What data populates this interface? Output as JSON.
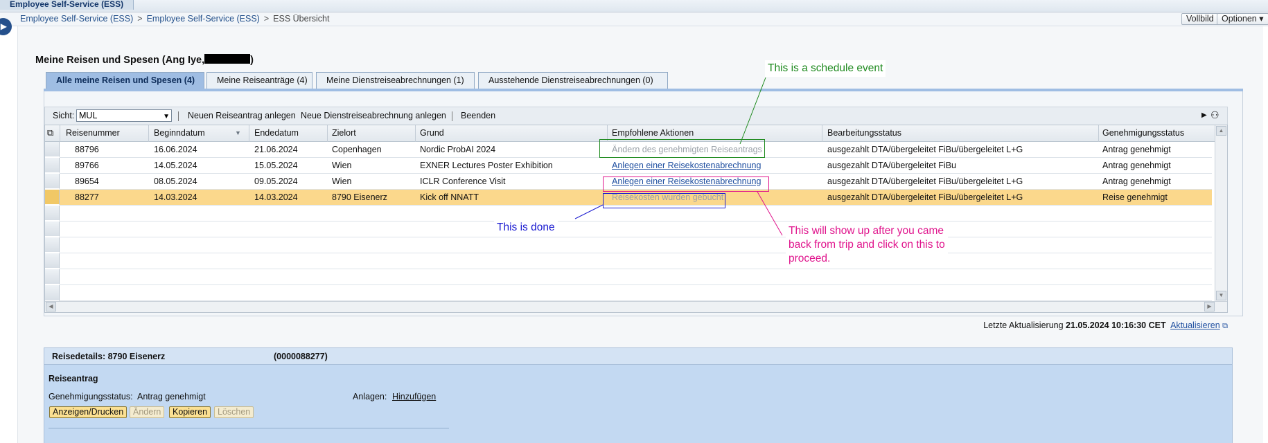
{
  "app": {
    "title": "Employee Self-Service (ESS)"
  },
  "breadcrumb": [
    "Employee Self-Service (ESS)",
    "Employee Self-Service (ESS)",
    "ESS Übersicht"
  ],
  "breadcrumb_separator": ">",
  "header_buttons": {
    "fullscreen": "Vollbild",
    "options": "Optionen"
  },
  "page": {
    "title_prefix": "Meine Reisen und Spesen (Ang Iye,",
    "title_suffix": ")"
  },
  "tabs": [
    {
      "label": "Alle meine Reisen und Spesen (4)",
      "active": true
    },
    {
      "label": "Meine Reiseanträge (4)",
      "active": false
    },
    {
      "label": "Meine Dienstreiseabrechnungen (1)",
      "active": false
    },
    {
      "label": "Ausstehende Dienstreiseabrechnungen (0)",
      "active": false
    }
  ],
  "toolbar": {
    "view_label": "Sicht:",
    "view_value": "MUL",
    "new_request": "Neuen Reiseantrag anlegen",
    "new_expense": "Neue Dienstreiseabrechnung anlegen",
    "finish": "Beenden"
  },
  "table": {
    "columns": [
      "Reisenummer",
      "Beginndatum",
      "Endedatum",
      "Zielort",
      "Grund",
      "Empfohlene Aktionen",
      "Bearbeitungsstatus",
      "Genehmigungsstatus"
    ],
    "rows": [
      {
        "number": "88796",
        "begin": "16.06.2024",
        "end": "21.06.2024",
        "destination": "Copenhagen",
        "reason": "Nordic ProbAI 2024",
        "action": "Ändern des genehmigten Reiseantrags",
        "action_type": "disabled",
        "processing_status": "ausgezahlt DTA/übergeleitet FiBu/übergeleitet L+G",
        "approval_status": "Antrag genehmigt"
      },
      {
        "number": "89766",
        "begin": "14.05.2024",
        "end": "15.05.2024",
        "destination": "Wien",
        "reason": "EXNER Lectures Poster Exhibition",
        "action": "Anlegen einer Reisekostenabrechnung",
        "action_type": "link",
        "processing_status": "ausgezahlt DTA/übergeleitet FiBu",
        "approval_status": "Antrag genehmigt"
      },
      {
        "number": "89654",
        "begin": "08.05.2024",
        "end": "09.05.2024",
        "destination": "Wien",
        "reason": "ICLR Conference Visit",
        "action": "Anlegen einer Reisekostenabrechnung",
        "action_type": "link",
        "processing_status": "ausgezahlt DTA/übergeleitet FiBu/übergeleitet L+G",
        "approval_status": "Antrag genehmigt"
      },
      {
        "number": "88277",
        "begin": "14.03.2024",
        "end": "14.03.2024",
        "destination": "8790 Eisenerz",
        "reason": "Kick off NNATT",
        "action": "Reisekosten wurden gebucht",
        "action_type": "disabled",
        "processing_status": "ausgezahlt DTA/übergeleitet FiBu/übergeleitet L+G",
        "approval_status": "Reise genehmigt",
        "selected": true
      }
    ]
  },
  "last_update": {
    "label": "Letzte Aktualisierung",
    "value": "21.05.2024 10:16:30 CET",
    "refresh": "Aktualisieren"
  },
  "details": {
    "header_label": "Reisedetails: 8790 Eisenerz",
    "header_id": "(0000088277)",
    "section": "Reiseantrag",
    "approval_label": "Genehmigungsstatus:",
    "approval_value": "Antrag genehmigt",
    "attachments_label": "Anlagen:",
    "attachments_link": "Hinzufügen",
    "buttons": {
      "display_print": "Anzeigen/Drucken",
      "change": "Ändern",
      "copy": "Kopieren",
      "delete": "Löschen"
    }
  },
  "annotations": {
    "schedule": "This is a schedule event",
    "done": "This is done",
    "after_trip": [
      "This will show up after you came",
      "back from trip and click on this to",
      "proceed."
    ],
    "colors": {
      "green": "#1e8a1e",
      "blue": "#1a1ad0",
      "magenta": "#e0138c"
    }
  },
  "colors": {
    "selected_row": "#fbd88c",
    "active_tab": "#9fbde3",
    "details_bg": "#c3d9f2",
    "link": "#1f4fa0"
  }
}
